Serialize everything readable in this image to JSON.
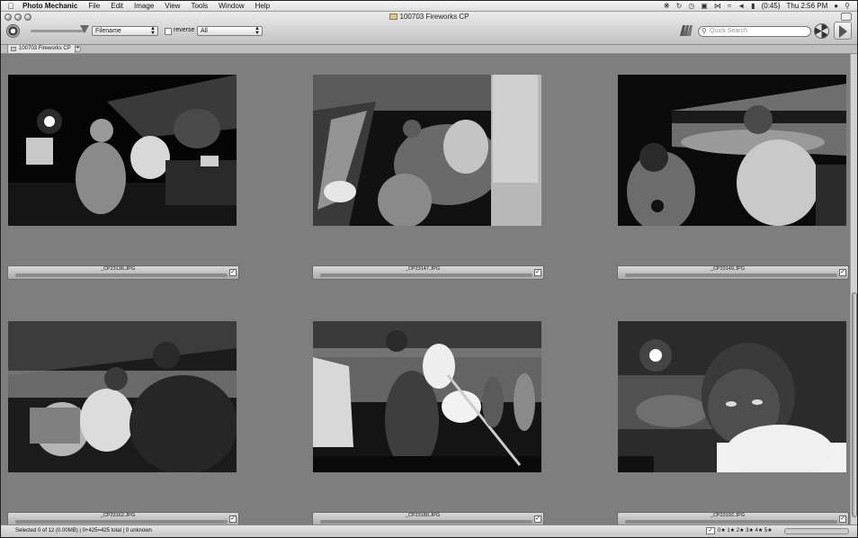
{
  "menubar": {
    "app_name": "Photo Mechanic",
    "items": [
      "File",
      "Edit",
      "Image",
      "View",
      "Tools",
      "Window",
      "Help"
    ],
    "battery": "(0:45)",
    "clock": "Thu 2:56 PM"
  },
  "window": {
    "title": "100703 Fireworks CP"
  },
  "toolbar": {
    "sort_select": "Filename",
    "reverse_label": "reverse",
    "filter_select": "All",
    "search_placeholder": "Quick Search"
  },
  "tabs": [
    {
      "label": "100703 Fireworks CP"
    }
  ],
  "thumbnails": [
    {
      "filename": "_CP23136.JPG"
    },
    {
      "filename": "_CP23147.JPG"
    },
    {
      "filename": "_CP23149.JPG"
    },
    {
      "filename": "_CP23162.JPG"
    },
    {
      "filename": "_CP23180.JPG"
    },
    {
      "filename": "_CP23192.JPG"
    }
  ],
  "status": {
    "text": "Selected 0 of 12 (0.00MB) | 0+425=425 total | 0 unknown",
    "ratings": "0★ 1★ 2★ 3★ 4★ 5★"
  }
}
